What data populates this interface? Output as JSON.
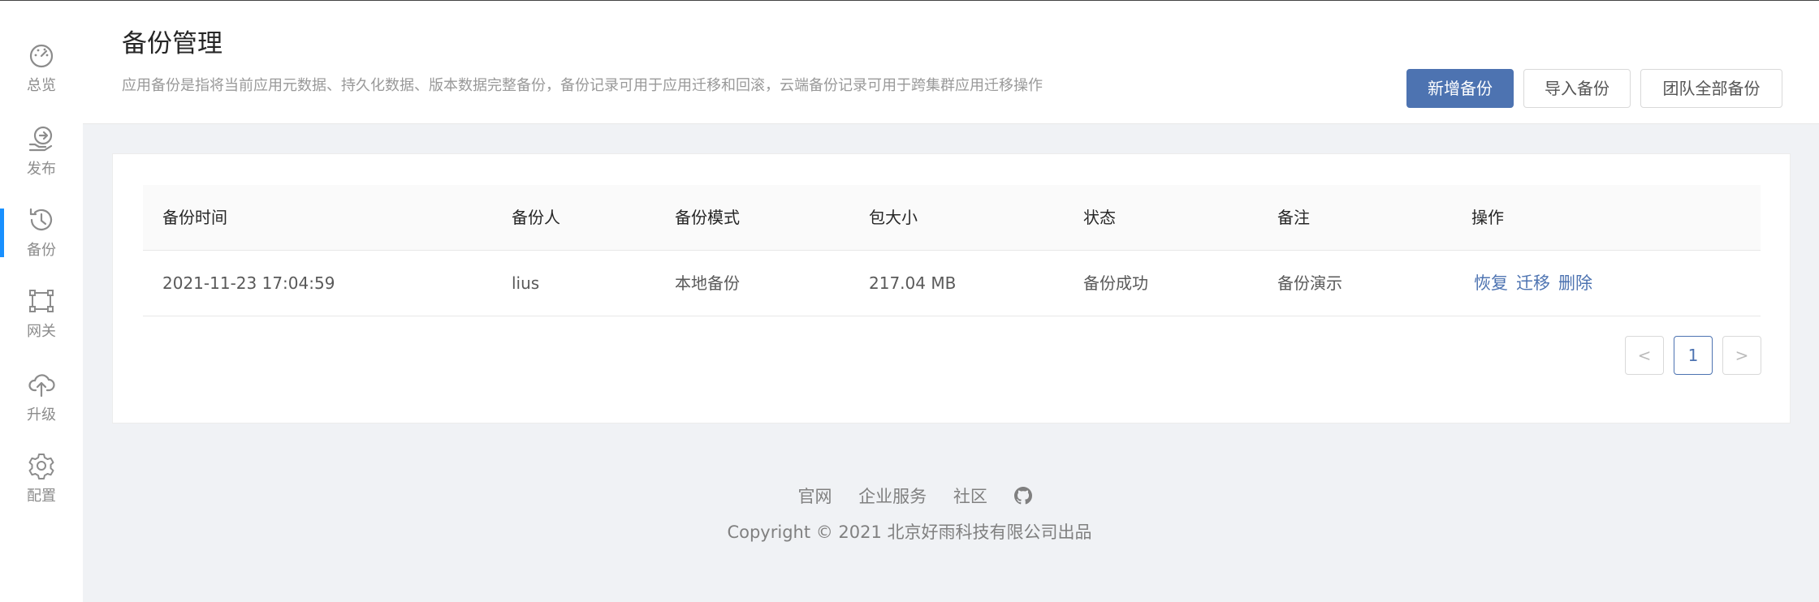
{
  "sidebar": {
    "items": [
      {
        "label": "总览",
        "icon": "dashboard-icon"
      },
      {
        "label": "发布",
        "icon": "publish-icon"
      },
      {
        "label": "备份",
        "icon": "history-icon",
        "active": true
      },
      {
        "label": "网关",
        "icon": "gateway-icon"
      },
      {
        "label": "升级",
        "icon": "upgrade-icon"
      },
      {
        "label": "配置",
        "icon": "settings-icon"
      }
    ]
  },
  "header": {
    "title": "备份管理",
    "description": "应用备份是指将当前应用元数据、持久化数据、版本数据完整备份，备份记录可用于应用迁移和回滚，云端备份记录可用于跨集群应用迁移操作",
    "buttons": {
      "add": "新增备份",
      "import": "导入备份",
      "team_all": "团队全部备份"
    }
  },
  "table": {
    "columns": [
      "备份时间",
      "备份人",
      "备份模式",
      "包大小",
      "状态",
      "备注",
      "操作"
    ],
    "rows": [
      {
        "time": "2021-11-23 17:04:59",
        "user": "lius",
        "mode": "本地备份",
        "size": "217.04 MB",
        "status": "备份成功",
        "note": "备份演示",
        "actions": [
          "恢复",
          "迁移",
          "删除"
        ]
      }
    ]
  },
  "pagination": {
    "prev": "<",
    "current": "1",
    "next": ">"
  },
  "footer": {
    "links": [
      "官网",
      "企业服务",
      "社区"
    ],
    "github_icon": "github-icon",
    "copyright": "Copyright © 2021 北京好雨科技有限公司出品"
  },
  "colors": {
    "primary": "#4d73b1",
    "active_indicator": "#1890ff"
  }
}
